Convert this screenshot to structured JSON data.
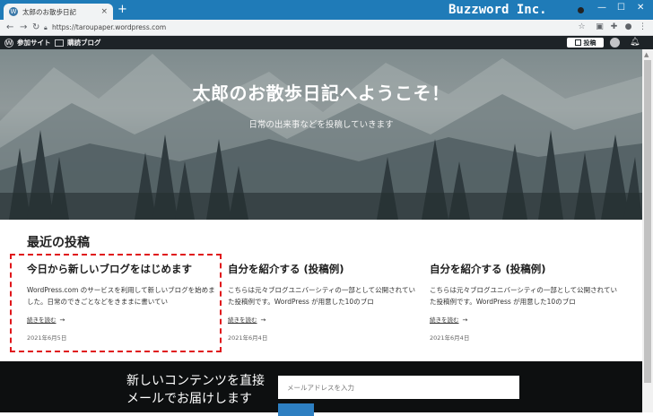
{
  "browser": {
    "tab_title": "太郎のお散歩日記",
    "tab_close": "×",
    "new_tab": "+",
    "brand": "Buzzword Inc.",
    "url": "https://taroupaper.wordpress.com",
    "window_min": "—",
    "window_max": "☐",
    "window_close": "✕"
  },
  "adminbar": {
    "sites_label": "参加サイト",
    "reader_label": "購読ブログ",
    "post_button": "投稿"
  },
  "hero": {
    "title": "太郎のお散歩日記へようこそ！",
    "subtitle": "日常の出来事などを投稿していきます"
  },
  "recent": {
    "heading": "最近の投稿",
    "posts": [
      {
        "title": "今日から新しいブログをはじめます",
        "excerpt": "WordPress.com のサービスを利用して新しいブログを始めました。日常のできごとなどをきままに書いてい",
        "more": "続きを読む",
        "arrow": "→",
        "date": "2021年6月5日"
      },
      {
        "title": "自分を紹介する (投稿例)",
        "excerpt": "こちらは元々ブログユニバーシティの一部として公開されていた投稿例です。WordPress が用意した10のブロ",
        "more": "続きを読む",
        "arrow": "→",
        "date": "2021年6月4日"
      },
      {
        "title": "自分を紹介する (投稿例)",
        "excerpt": "こちらは元々ブログユニバーシティの一部として公開されていた投稿例です。WordPress が用意した10のブロ",
        "more": "続きを読む",
        "arrow": "→",
        "date": "2021年6月4日"
      }
    ]
  },
  "newsletter": {
    "text": "新しいコンテンツを直接メールでお届けします",
    "email_placeholder": "メールアドレスを入力"
  },
  "colors": {
    "highlight": "#e0161b",
    "titlebar": "#1f7bb8",
    "submit": "#2d7fc2"
  }
}
